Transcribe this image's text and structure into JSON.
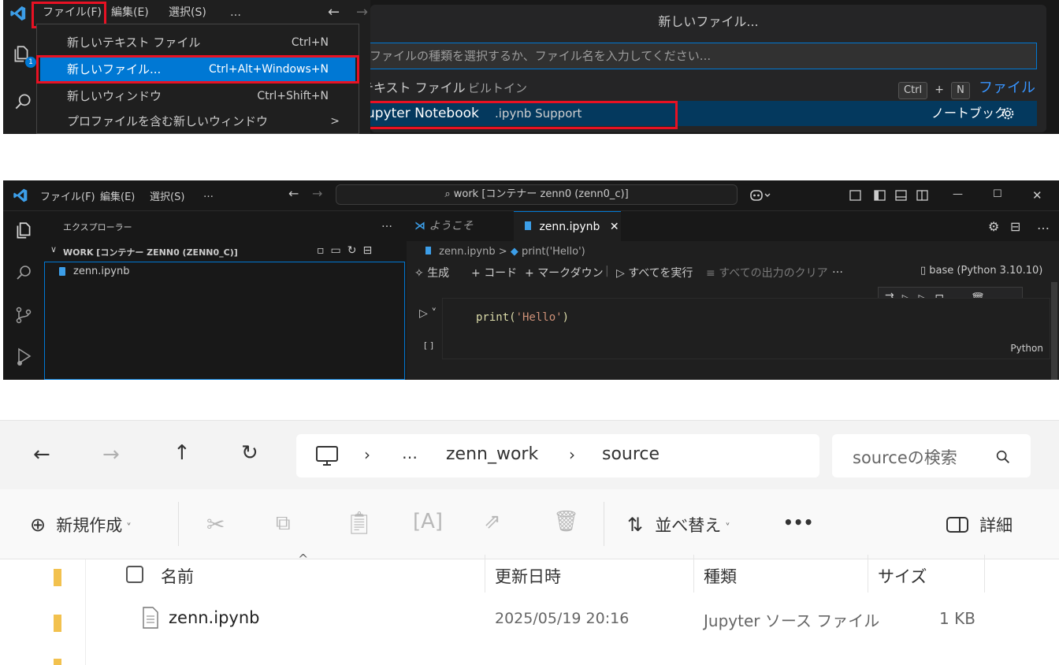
{
  "vscode_menu": {
    "menubar": [
      "ファイル(F)",
      "編集(E)",
      "選択(S)",
      "…"
    ],
    "items": [
      {
        "label": "新しいテキスト ファイル",
        "shortcut": "Ctrl+N"
      },
      {
        "label": "新しいファイル...",
        "shortcut": "Ctrl+Alt+Windows+N"
      },
      {
        "label": "新しいウィンドウ",
        "shortcut": "Ctrl+Shift+N"
      },
      {
        "label": "プロファイルを含む新しいウィンドウ",
        "shortcut": ">"
      }
    ]
  },
  "quick_pick": {
    "title": "新しいファイル...",
    "placeholder": "ファイルの種類を選択するか、ファイル名を入力してください...",
    "items": [
      {
        "label": "テキスト ファイル",
        "detail": "ビルトイン",
        "keys": [
          "Ctrl",
          "+",
          "N"
        ],
        "category": "ファイル"
      },
      {
        "label": "Jupyter Notebook",
        "detail": ".ipynb Support",
        "category": "ノートブック"
      }
    ]
  },
  "vscode_window": {
    "menubar": [
      "ファイル(F)",
      "編集(E)",
      "選択(S)",
      "…"
    ],
    "command_center": "work [コンテナー zenn0 (zenn0_c)]",
    "sidebar": {
      "title": "エクスプローラー",
      "more": "…",
      "section": "WORK [コンテナー ZENN0 (ZENN0_C)]",
      "files": [
        "zenn.ipynb"
      ]
    },
    "tabs": [
      {
        "label": "ようこそ",
        "close": ""
      },
      {
        "label": "zenn.ipynb",
        "close": "✕"
      }
    ],
    "breadcrumb": [
      "zenn.ipynb",
      ">",
      "print('Hello')"
    ],
    "toolbar": {
      "generate": "生成",
      "code": "コード",
      "markdown": "マークダウン",
      "run_all": "すべてを実行",
      "clear_all": "すべての出力のクリア",
      "more": "…",
      "kernel": "base (Python 3.10.10)"
    },
    "cell": {
      "code_fn": "print(",
      "code_str": "'Hello'",
      "code_end": ")",
      "exec_count": "[ ]",
      "language": "Python"
    }
  },
  "explorer": {
    "breadcrumb": [
      "…",
      "zenn_work",
      "source"
    ],
    "search_placeholder": "sourceの検索",
    "commands": {
      "new": "新規作成",
      "sort": "並べ替え",
      "more": "•••",
      "details": "詳細"
    },
    "columns": [
      "名前",
      "更新日時",
      "種類",
      "サイズ"
    ],
    "rows": [
      {
        "name": "zenn.ipynb",
        "modified": "2025/05/19 20:16",
        "type": "Jupyter ソース ファイル",
        "size": "1 KB"
      }
    ]
  },
  "colors": {
    "accent": "#0078d4",
    "highlight": "#e81123",
    "vscode_bg": "#181818"
  }
}
